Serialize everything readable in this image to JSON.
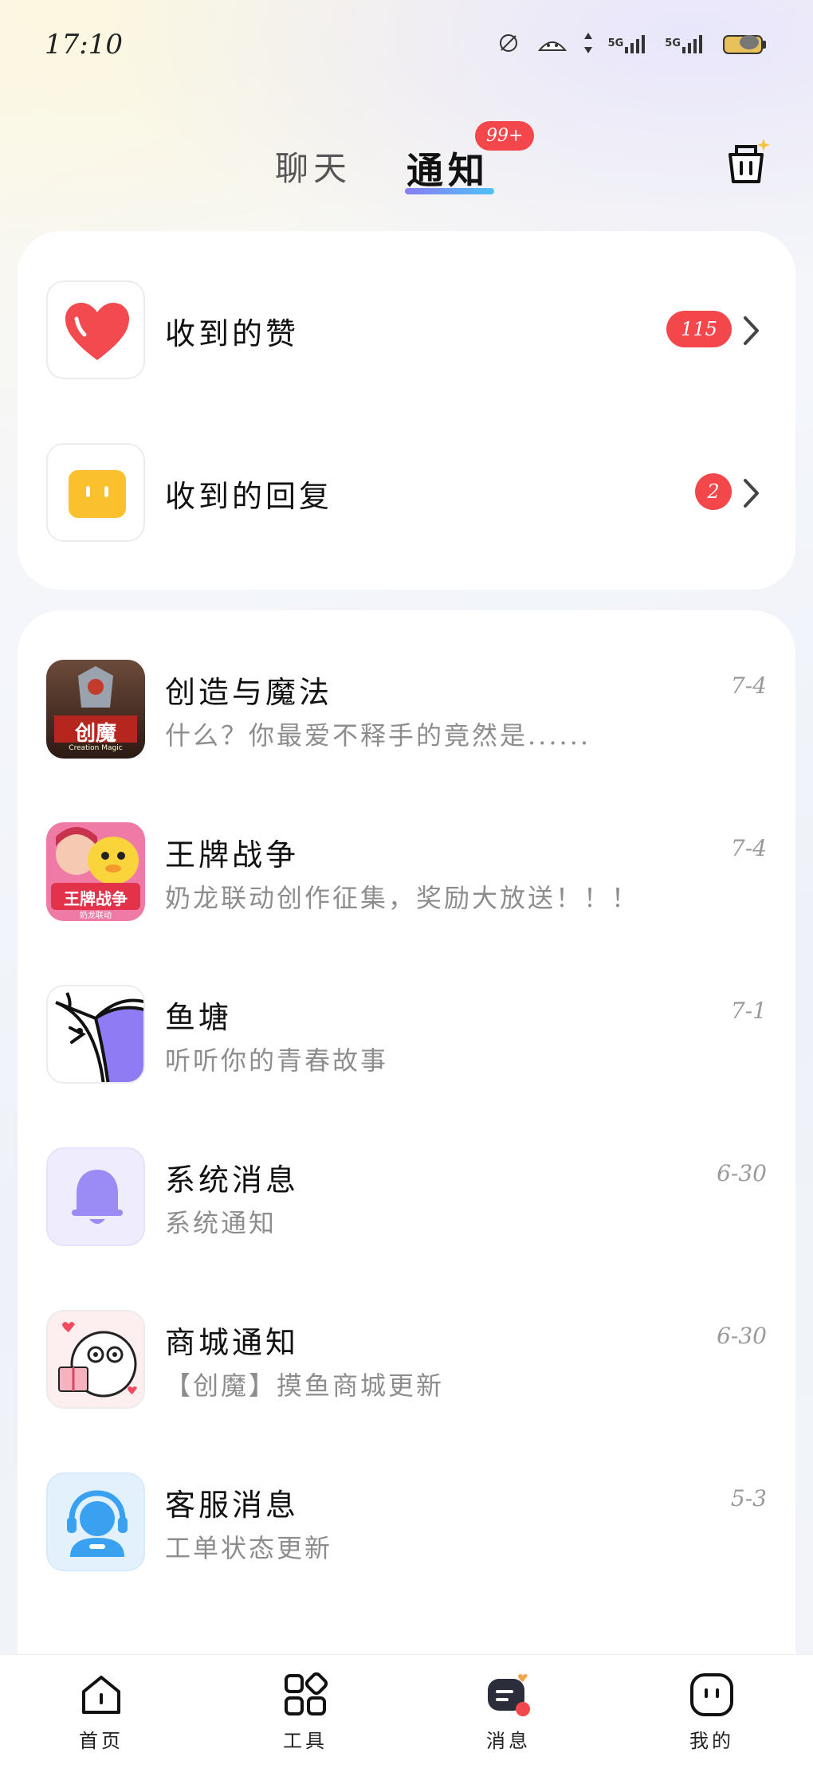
{
  "status_bar": {
    "time": "17:10",
    "network_1": "5G",
    "network_2": "5G"
  },
  "top_tabs": {
    "chat_label": "聊天",
    "notify_label": "通知",
    "notify_badge": "99+",
    "clean_icon": "broom-bucket-icon"
  },
  "top_card": {
    "items": [
      {
        "label": "收到的赞",
        "badge": "115",
        "icon": "heart-icon"
      },
      {
        "label": "收到的回复",
        "badge": "2",
        "icon": "reply-face-icon"
      }
    ]
  },
  "list": {
    "items": [
      {
        "title": "创造与魔法",
        "subtitle": "什么？你最爱不释手的竟然是......",
        "date": "7-4",
        "icon": "creation-magic-game-icon",
        "logo_text": "创魔",
        "logo_sub": "Creation Magic"
      },
      {
        "title": "王牌战争",
        "subtitle": "奶龙联动创作征集，奖励大放送！！！",
        "date": "7-4",
        "icon": "ace-war-game-icon",
        "logo_text": "王牌战争",
        "logo_sub": "奶龙联动"
      },
      {
        "title": "鱼塘",
        "subtitle": "听听你的青春故事",
        "date": "7-1",
        "icon": "fish-pond-icon"
      },
      {
        "title": "系统消息",
        "subtitle": "系统通知",
        "date": "6-30",
        "icon": "bell-icon"
      },
      {
        "title": "商城通知",
        "subtitle": "【创魔】摸鱼商城更新",
        "date": "6-30",
        "icon": "mall-mascot-icon"
      },
      {
        "title": "客服消息",
        "subtitle": "工单状态更新",
        "date": "5-3",
        "icon": "customer-service-icon"
      }
    ]
  },
  "bottom_nav": {
    "items": [
      {
        "label": "首页",
        "icon": "home-icon"
      },
      {
        "label": "工具",
        "icon": "tools-grid-icon"
      },
      {
        "label": "消息",
        "icon": "message-icon",
        "active": true
      },
      {
        "label": "我的",
        "icon": "profile-face-icon"
      }
    ]
  },
  "colors": {
    "accent_red": "#f4474b",
    "tab_gradient_start": "#8a7cf4",
    "tab_gradient_end": "#4dc3f5",
    "bell_purple": "#9b8cf5",
    "reply_yellow": "#fbc02d",
    "service_blue": "#3aa0f0"
  }
}
